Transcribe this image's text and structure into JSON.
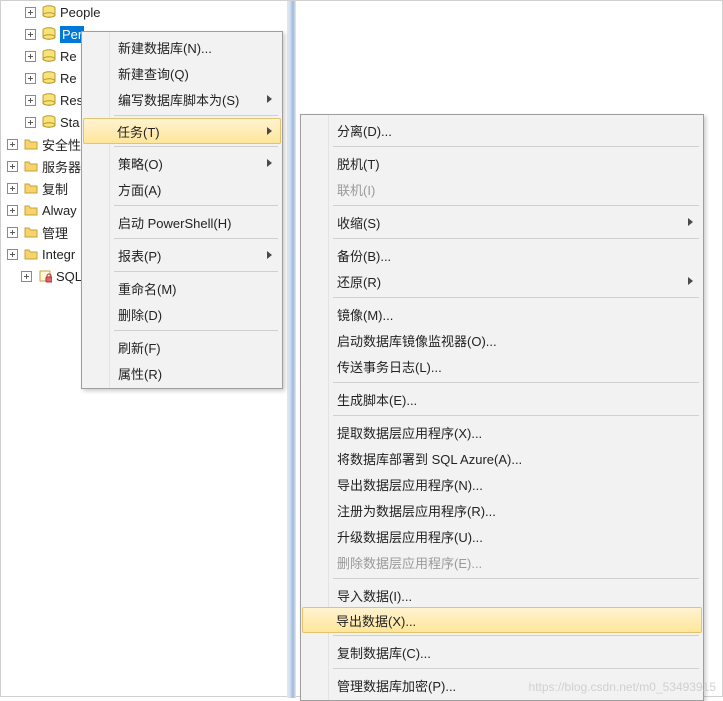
{
  "tree": {
    "items": [
      {
        "kind": "db",
        "indent": 24,
        "label": "People"
      },
      {
        "kind": "db-sel",
        "indent": 24,
        "label": "Per"
      },
      {
        "kind": "db",
        "indent": 24,
        "label": "Re"
      },
      {
        "kind": "db",
        "indent": 24,
        "label": "Re"
      },
      {
        "kind": "db",
        "indent": 24,
        "label": "Res"
      },
      {
        "kind": "db",
        "indent": 24,
        "label": "Sta"
      },
      {
        "kind": "folder",
        "indent": 6,
        "label": "安全性"
      },
      {
        "kind": "folder",
        "indent": 6,
        "label": "服务器"
      },
      {
        "kind": "folder",
        "indent": 6,
        "label": "复制"
      },
      {
        "kind": "folder",
        "indent": 6,
        "label": "Alway"
      },
      {
        "kind": "folder",
        "indent": 6,
        "label": "管理"
      },
      {
        "kind": "folder",
        "indent": 6,
        "label": "Integr"
      },
      {
        "kind": "lock",
        "indent": 20,
        "label": "SQL S"
      }
    ]
  },
  "menu1": [
    {
      "type": "item",
      "label": "新建数据库(N)..."
    },
    {
      "type": "item",
      "label": "新建查询(Q)"
    },
    {
      "type": "item",
      "label": "编写数据库脚本为(S)",
      "submenu": true
    },
    {
      "type": "sep"
    },
    {
      "type": "item",
      "label": "任务(T)",
      "submenu": true,
      "highlight": true
    },
    {
      "type": "sep"
    },
    {
      "type": "item",
      "label": "策略(O)",
      "submenu": true
    },
    {
      "type": "item",
      "label": "方面(A)"
    },
    {
      "type": "sep"
    },
    {
      "type": "item",
      "label": "启动 PowerShell(H)"
    },
    {
      "type": "sep"
    },
    {
      "type": "item",
      "label": "报表(P)",
      "submenu": true
    },
    {
      "type": "sep"
    },
    {
      "type": "item",
      "label": "重命名(M)"
    },
    {
      "type": "item",
      "label": "删除(D)"
    },
    {
      "type": "sep"
    },
    {
      "type": "item",
      "label": "刷新(F)"
    },
    {
      "type": "item",
      "label": "属性(R)"
    }
  ],
  "menu2": [
    {
      "type": "item",
      "label": "分离(D)..."
    },
    {
      "type": "sep"
    },
    {
      "type": "item",
      "label": "脱机(T)"
    },
    {
      "type": "item",
      "label": "联机(I)",
      "disabled": true
    },
    {
      "type": "sep"
    },
    {
      "type": "item",
      "label": "收缩(S)",
      "submenu": true
    },
    {
      "type": "sep"
    },
    {
      "type": "item",
      "label": "备份(B)..."
    },
    {
      "type": "item",
      "label": "还原(R)",
      "submenu": true
    },
    {
      "type": "sep"
    },
    {
      "type": "item",
      "label": "镜像(M)..."
    },
    {
      "type": "item",
      "label": "启动数据库镜像监视器(O)..."
    },
    {
      "type": "item",
      "label": "传送事务日志(L)..."
    },
    {
      "type": "sep"
    },
    {
      "type": "item",
      "label": "生成脚本(E)..."
    },
    {
      "type": "sep"
    },
    {
      "type": "item",
      "label": "提取数据层应用程序(X)..."
    },
    {
      "type": "item",
      "label": "将数据库部署到 SQL Azure(A)..."
    },
    {
      "type": "item",
      "label": "导出数据层应用程序(N)..."
    },
    {
      "type": "item",
      "label": "注册为数据层应用程序(R)..."
    },
    {
      "type": "item",
      "label": "升级数据层应用程序(U)..."
    },
    {
      "type": "item",
      "label": "删除数据层应用程序(E)...",
      "disabled": true
    },
    {
      "type": "sep"
    },
    {
      "type": "item",
      "label": "导入数据(I)..."
    },
    {
      "type": "item",
      "label": "导出数据(X)...",
      "highlight": true
    },
    {
      "type": "sep"
    },
    {
      "type": "item",
      "label": "复制数据库(C)..."
    },
    {
      "type": "sep"
    },
    {
      "type": "item",
      "label": "管理数据库加密(P)..."
    }
  ],
  "watermark": "https://blog.csdn.net/m0_53493915"
}
